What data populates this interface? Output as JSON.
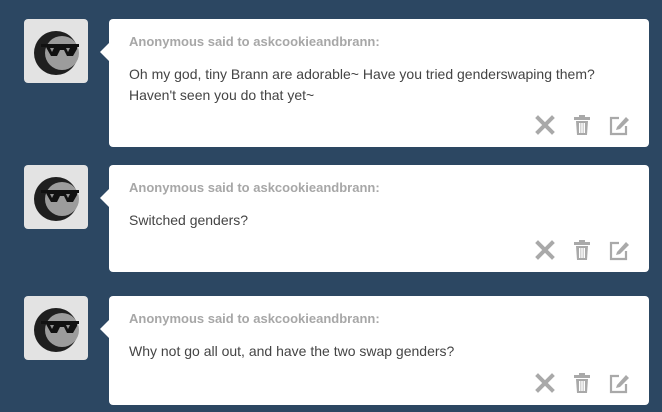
{
  "messages": [
    {
      "asker": "Anonymous said to askcookieandbrann:",
      "question": "Oh my god, tiny Brann are adorable~ Have you tried genderswaping them? Haven't seen you do that yet~"
    },
    {
      "asker": "Anonymous said to askcookieandbrann:",
      "question": "Switched genders?"
    },
    {
      "asker": "Anonymous said to askcookieandbrann:",
      "question": "Why not go all out, and have the two swap genders?"
    }
  ],
  "icons": {
    "avatar": "anonymous-sunglasses-avatar",
    "delete": "x-icon",
    "trash": "trash-icon",
    "edit": "edit-icon"
  },
  "colors": {
    "background": "#2c4762",
    "card": "#ffffff",
    "asker_text": "#a7a7a7",
    "question_text": "#444444",
    "icon": "#a9a9a9"
  }
}
